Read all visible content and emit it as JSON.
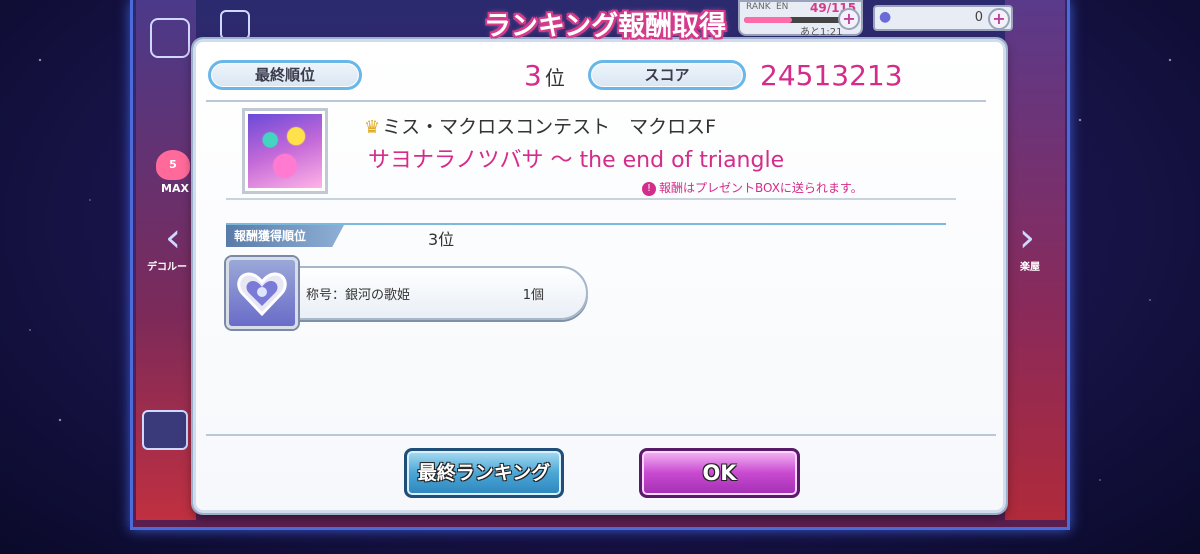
{
  "title": "ランキング報酬取得",
  "hud": {
    "rank_label": "RANK",
    "en_label": "EN",
    "ep_count": "49/115",
    "ep_fraction": 0.426,
    "timer": "あと1:21",
    "gem_count": "0",
    "plus": "+"
  },
  "side": {
    "left_label_1": "MAX",
    "left_label_2": "デコルー",
    "right_label": "楽屋",
    "level_badge": "5"
  },
  "dialog": {
    "final_rank_label": "最終順位",
    "final_rank_value": "3",
    "rank_suffix": "位",
    "score_label": "スコア",
    "score_value": "24513213",
    "song_group": "ミス・マクロスコンテスト　マクロスF",
    "song_title": "サヨナラノツバサ ～ the end of triangle",
    "notice_mark": "!",
    "notice": "報酬はプレゼントBOXに送られます。",
    "reward_tab_label": "報酬獲得順位",
    "reward_rank": "3位",
    "reward_item_name": "称号：銀河の歌姫",
    "reward_item_qty": "1個"
  },
  "buttons": {
    "final_ranking": "最終ランキング",
    "ok": "OK"
  },
  "colors": {
    "accent_pink": "#d42c8a",
    "pill_border": "#69b7e8",
    "ok_button": "#c94ad0",
    "final_button": "#4ba6d6"
  }
}
